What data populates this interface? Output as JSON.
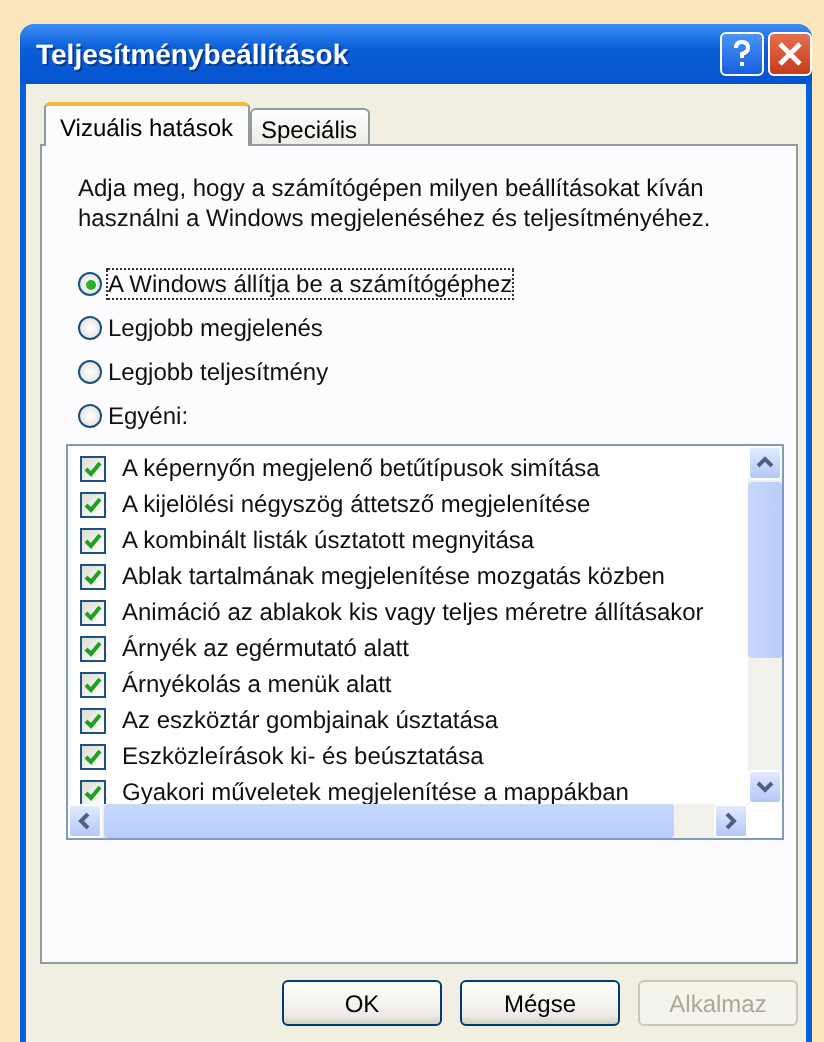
{
  "window": {
    "title": "Teljesítménybeállítások"
  },
  "tabs": [
    {
      "label": "Vizuális hatások",
      "selected": true
    },
    {
      "label": "Speciális",
      "selected": false
    }
  ],
  "description": "Adja meg, hogy a számítógépen milyen beállításokat kíván használni a Windows megjelenéséhez és teljesítményéhez.",
  "options": [
    {
      "label": "A Windows állítja be a számítógéphez",
      "selected": true
    },
    {
      "label": "Legjobb megjelenés",
      "selected": false
    },
    {
      "label": "Legjobb teljesítmény",
      "selected": false
    },
    {
      "label": "Egyéni:",
      "selected": false
    }
  ],
  "effects": [
    {
      "label": "A képernyőn megjelenő betűtípusok simítása",
      "checked": true
    },
    {
      "label": "A kijelölési négyszög áttetsző megjelenítése",
      "checked": true
    },
    {
      "label": "A kombinált listák úsztatott megnyitása",
      "checked": true
    },
    {
      "label": "Ablak tartalmának megjelenítése mozgatás közben",
      "checked": true
    },
    {
      "label": "Animáció az ablakok kis vagy teljes méretre állításakor",
      "checked": true
    },
    {
      "label": "Árnyék az egérmutató alatt",
      "checked": true
    },
    {
      "label": "Árnyékolás a menük alatt",
      "checked": true
    },
    {
      "label": "Az eszköztár gombjainak úsztatása",
      "checked": true
    },
    {
      "label": "Eszközleírások ki- és beúsztatása",
      "checked": true
    },
    {
      "label": "Gyakori műveletek megjelenítése a mappákban",
      "checked": true
    }
  ],
  "buttons": [
    {
      "label": "OK",
      "disabled": false
    },
    {
      "label": "Mégse",
      "disabled": false
    },
    {
      "label": "Alkalmaz",
      "disabled": true
    }
  ]
}
